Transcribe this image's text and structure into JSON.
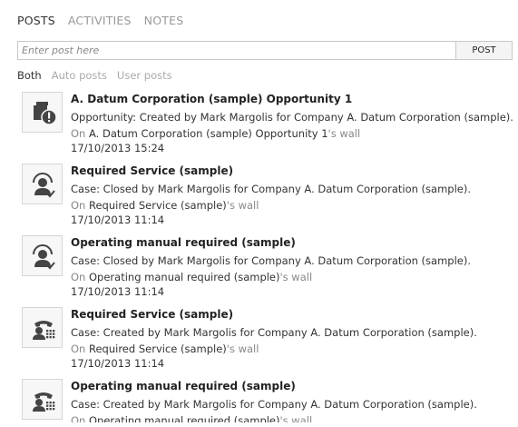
{
  "tabs": [
    "POSTS",
    "ACTIVITIES",
    "NOTES"
  ],
  "post_input_placeholder": "Enter post here",
  "post_button": "POST",
  "filters": [
    "Both",
    "Auto posts",
    "User posts"
  ],
  "on_label": "On",
  "wall_suffix": "'s wall",
  "items": [
    {
      "icon": "opportunity-alert-icon",
      "title": "A. Datum Corporation (sample) Opportunity 1",
      "description": "Opportunity: Created by Mark Margolis for Company A. Datum Corporation (sample).",
      "wall_name": "A. Datum Corporation (sample) Opportunity 1",
      "timestamp": "17/10/2013 15:24"
    },
    {
      "icon": "case-resolved-icon",
      "title": "Required Service (sample)",
      "description": "Case: Closed by Mark Margolis for Company A. Datum Corporation (sample).",
      "wall_name": "Required Service (sample)",
      "timestamp": "17/10/2013 11:14"
    },
    {
      "icon": "case-resolved-icon",
      "title": "Operating manual required (sample)",
      "description": "Case: Closed by Mark Margolis for Company A. Datum Corporation (sample).",
      "wall_name": "Operating manual required (sample)",
      "timestamp": "17/10/2013 11:14"
    },
    {
      "icon": "phone-case-icon",
      "title": "Required Service (sample)",
      "description": "Case: Created by Mark Margolis for Company A. Datum Corporation (sample).",
      "wall_name": "Required Service (sample)",
      "timestamp": "17/10/2013 11:14"
    },
    {
      "icon": "phone-case-icon",
      "title": "Operating manual required (sample)",
      "description": "Case: Created by Mark Margolis for Company A. Datum Corporation (sample).",
      "wall_name": "Operating manual required (sample)",
      "timestamp": ""
    }
  ]
}
